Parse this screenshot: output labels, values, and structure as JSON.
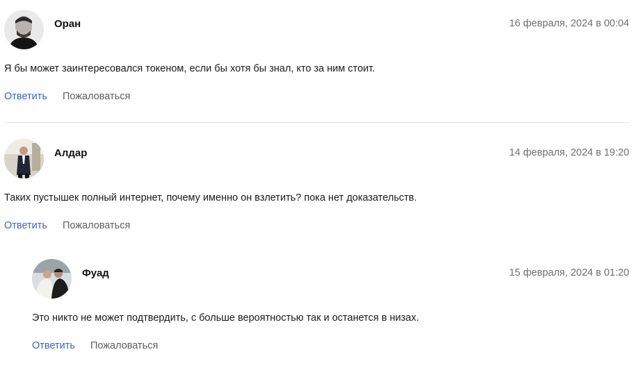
{
  "comments": [
    {
      "author": "Оран",
      "date": "16 февраля, 2024 в 00:04",
      "text": "Я бы может заинтересовался токеном, если бы хотя бы знал, кто за ним стоит.",
      "reply_label": "Ответить",
      "report_label": "Пожаловаться"
    },
    {
      "author": "Алдар",
      "date": "14 февраля, 2024 в 19:20",
      "text": "Таких пустышек полный интернет, почему именно он взлетить? пока нет доказательств.",
      "reply_label": "Ответить",
      "report_label": "Пожаловаться",
      "replies": [
        {
          "author": "Фуад",
          "date": "15 февраля, 2024 в 01:20",
          "text": "Это никто не может подтвердить, с больше вероятностью так и останется в низах.",
          "reply_label": "Ответить",
          "report_label": "Пожаловаться"
        }
      ]
    }
  ],
  "colors": {
    "link_blue": "#3a63c7",
    "muted_gray": "#6f6f6f",
    "separator": "#e6e6ea"
  },
  "icons": [
    "avatar-photo-oran",
    "avatar-photo-aldar",
    "avatar-photo-fuad"
  ]
}
